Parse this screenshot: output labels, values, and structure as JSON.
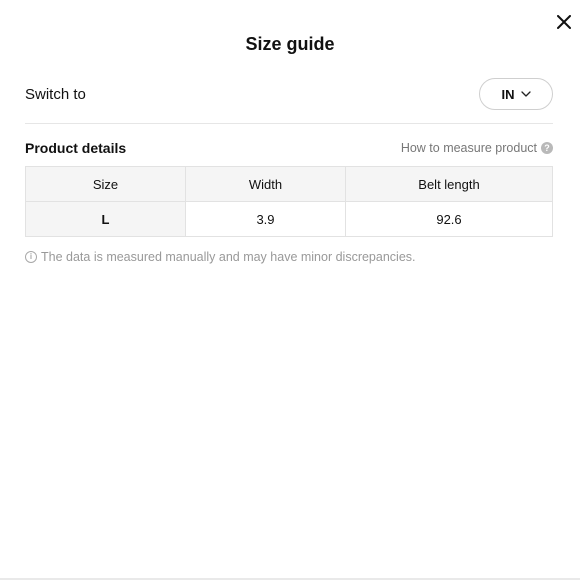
{
  "dialog": {
    "title": "Size guide",
    "close_icon": "close-icon"
  },
  "switch": {
    "label": "Switch to",
    "selected_unit": "IN",
    "dropdown_icon": "chevron-down-icon"
  },
  "details": {
    "title": "Product details",
    "measure_link": "How to measure product",
    "help_icon_glyph": "?"
  },
  "table": {
    "headers": [
      "Size",
      "Width",
      "Belt length"
    ],
    "rows": [
      [
        "L",
        "3.9",
        "92.6"
      ]
    ]
  },
  "note": {
    "icon_glyph": "i",
    "text": "The data is measured manually and may have minor discrepancies."
  }
}
